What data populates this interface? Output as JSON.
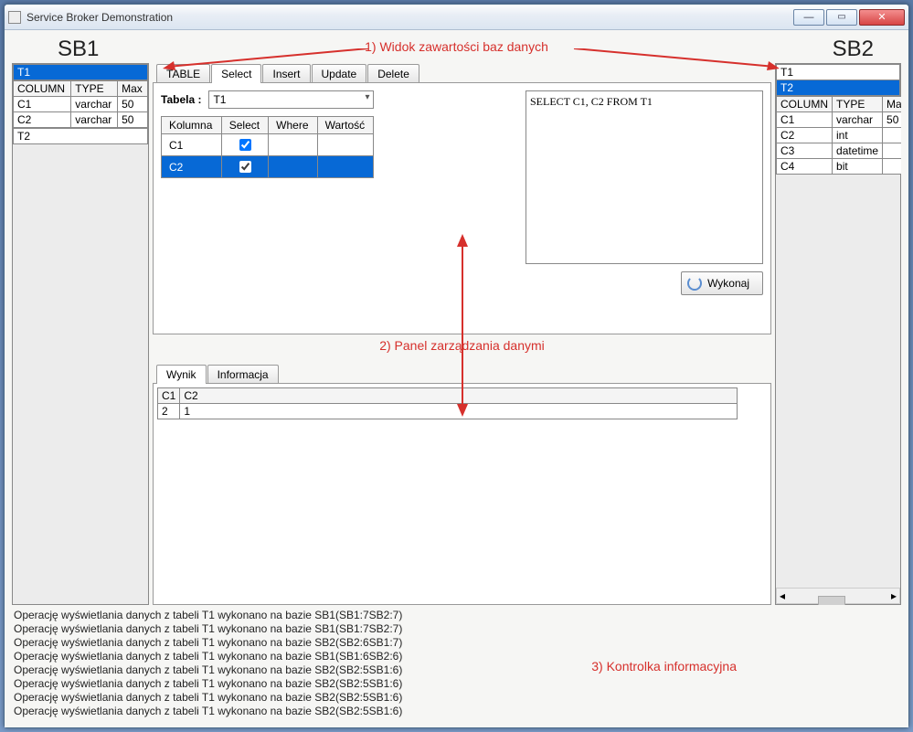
{
  "window": {
    "title": "Service Broker Demonstration"
  },
  "headers": {
    "left": "SB1",
    "right": "SB2"
  },
  "annotations": {
    "views": "1) Widok zawartości baz danych",
    "panel": "2) Panel zarządzania danymi",
    "log": "3) Kontrolka informacyjna"
  },
  "sb1": {
    "tables": [
      {
        "name": "T1",
        "selected": true
      },
      {
        "name": "T2",
        "selected": false
      }
    ],
    "grid_headers": {
      "col": "COLUMN",
      "type": "TYPE",
      "max": "Max"
    },
    "columns": [
      {
        "col": "C1",
        "type": "varchar",
        "max": "50"
      },
      {
        "col": "C2",
        "type": "varchar",
        "max": "50"
      }
    ]
  },
  "sb2": {
    "tables": [
      {
        "name": "T1",
        "selected": false
      },
      {
        "name": "T2",
        "selected": true
      }
    ],
    "grid_headers": {
      "col": "COLUMN",
      "type": "TYPE",
      "max": "Max"
    },
    "columns": [
      {
        "col": "C1",
        "type": "varchar",
        "max": "50"
      },
      {
        "col": "C2",
        "type": "int",
        "max": ""
      },
      {
        "col": "C3",
        "type": "datetime",
        "max": ""
      },
      {
        "col": "C4",
        "type": "bit",
        "max": ""
      }
    ]
  },
  "center": {
    "tabs": {
      "table": "TABLE",
      "select": "Select",
      "insert": "Insert",
      "update": "Update",
      "delete": "Delete"
    },
    "active_tab": "select",
    "tabela_label": "Tabela :",
    "tabela_value": "T1",
    "col_headers": {
      "kolumna": "Kolumna",
      "select": "Select",
      "where": "Where",
      "wartosc": "Wartość"
    },
    "col_rows": [
      {
        "name": "C1",
        "select": true,
        "where": false,
        "value": "",
        "selected": false
      },
      {
        "name": "C2",
        "select": true,
        "where": false,
        "value": "",
        "selected": true
      }
    ],
    "sql": "SELECT C1,  C2  FROM T1",
    "execute_label": "Wykonaj"
  },
  "result": {
    "tabs": {
      "wynik": "Wynik",
      "info": "Informacja"
    },
    "active_tab": "wynik",
    "columns": [
      "C1",
      "C2"
    ],
    "rows": [
      [
        "2",
        "1"
      ]
    ]
  },
  "log": [
    "Operację wyświetlania danych z tabeli T1 wykonano na bazie SB1(SB1:7SB2:7)",
    "Operację wyświetlania danych z tabeli T1 wykonano na bazie SB1(SB1:7SB2:7)",
    "Operację wyświetlania danych z tabeli T1 wykonano na bazie SB2(SB2:6SB1:7)",
    "Operację wyświetlania danych z tabeli T1 wykonano na bazie SB1(SB1:6SB2:6)",
    "Operację wyświetlania danych z tabeli T1 wykonano na bazie SB2(SB2:5SB1:6)",
    "Operację wyświetlania danych z tabeli T1 wykonano na bazie SB2(SB2:5SB1:6)",
    "Operację wyświetlania danych z tabeli T1 wykonano na bazie SB2(SB2:5SB1:6)",
    "Operację wyświetlania danych z tabeli T1 wykonano na bazie SB2(SB2:5SB1:6)"
  ]
}
